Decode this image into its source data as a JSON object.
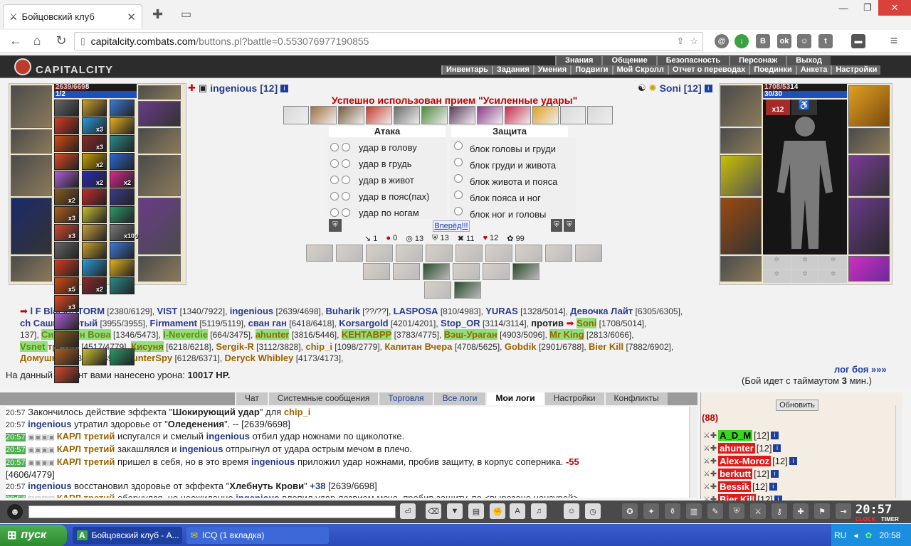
{
  "browser": {
    "tab_title": "Бойцовский клуб",
    "url_host": "capitalcity.combats.com",
    "url_path": "/buttons.pl?battle=0.553076977190855"
  },
  "site": {
    "logo": "CAPITALCITY",
    "menu_top": [
      "Знания",
      "Общение",
      "Безопасность",
      "Персонаж",
      "Выход"
    ],
    "menu_bottom": [
      "Инвентарь",
      "Задания",
      "Умения",
      "Подвиги",
      "Мой Скролл",
      "Отчет о переводах",
      "Поединки",
      "Анкета",
      "Настройки"
    ]
  },
  "battle": {
    "left_name": "ingenious [12]",
    "left_hp": "2639/6698",
    "left_mana": "1/2",
    "right_name": "Soni [12]",
    "right_hp": "1708/5314",
    "right_mana": "30/30",
    "right_buff": "x12",
    "used_msg": "Успешно использован прием \"Усиленные удары\"",
    "attack_title": "Атака",
    "defense_title": "Защита",
    "attacks": [
      "удар в голову",
      "удар в грудь",
      "удар в живот",
      "удар в пояс(пах)",
      "удар по ногам"
    ],
    "defenses": [
      "блок головы и груди",
      "блок груди и живота",
      "блок живота и пояса",
      "блок пояса и ног",
      "блок ног и головы"
    ],
    "forward": "Вперёд!!!",
    "stats": [
      "1",
      "0",
      "13",
      "13",
      "11",
      "12",
      "99"
    ],
    "spell_badges": [
      "x3",
      "x3",
      "x2",
      "x2",
      "x2",
      "x2",
      "x3",
      "x3",
      "x100",
      "x5",
      "x2",
      "x3"
    ]
  },
  "players": [
    {
      "n": "Black-STORM",
      "h": "[2380/6129]",
      "c": "pn"
    },
    {
      "n": "VIST",
      "h": "[1340/7922]",
      "c": "pn"
    },
    {
      "n": "ingenious",
      "h": "[2639/4698]",
      "c": "pn"
    },
    {
      "n": "Buharik",
      "h": "[??/??]",
      "c": "pn"
    },
    {
      "n": "LASPOSA",
      "h": "[810/4983]",
      "c": "pn"
    },
    {
      "n": "YURAS",
      "h": "[1328/5014]",
      "c": "pn"
    },
    {
      "n": "Девочка Лайт",
      "h": "[6305/6305]",
      "c": "pn"
    },
    {
      "n": "Сашка Лютый",
      "h": "[3955/3955]",
      "c": "pn"
    },
    {
      "n": "Firmament",
      "h": "[5119/5119]",
      "c": "pn"
    },
    {
      "n": "сван ган",
      "h": "[6418/6418]",
      "c": "pn"
    },
    {
      "n": "Korsargold",
      "h": "[4201/4201]",
      "c": "pn"
    },
    {
      "n": "Stop_OR",
      "h": "[3114/3114]",
      "c": "pn"
    },
    {
      "n": "Сироткин Вова",
      "h": "[1346/5473]",
      "c": "pg"
    },
    {
      "n": "I-Neverdie",
      "h": "[664/3475]",
      "c": "pg"
    },
    {
      "n": "ahunter",
      "h": "[3816/5446]",
      "c": "pb"
    },
    {
      "n": "KEHTABPP",
      "h": "[3783/4775]",
      "c": "pb"
    },
    {
      "n": "Вэш-Ураган",
      "h": "[4903/5096]",
      "c": "pb"
    },
    {
      "n": "Mr King",
      "h": "[2813/6066]",
      "c": "pb"
    },
    {
      "n": "третий",
      "h": "[4517/4779]",
      "c": "pb"
    },
    {
      "n": "Кисуня",
      "h": "[6218/6218]",
      "c": "pb"
    },
    {
      "n": "Sergik-R",
      "h": "[3112/3828]",
      "c": "pb"
    },
    {
      "n": "chip_i",
      "h": "[1098/2779]",
      "c": "pb"
    },
    {
      "n": "Капитан Вчера",
      "h": "[4708/5625]",
      "c": "pb"
    },
    {
      "n": "Gobdik",
      "h": "[2901/6788]",
      "c": "pb"
    },
    {
      "n": "Bier Kill",
      "h": "[7882/6902]",
      "c": "pb"
    },
    {
      "n": "Домушник",
      "h": "[6349/6349]",
      "c": "pb"
    },
    {
      "n": "CounterSpy",
      "h": "[6128/6371]",
      "c": "pb"
    },
    {
      "n": "Deryck Whibley",
      "h": "[4173/4173]",
      "c": "pb"
    }
  ],
  "players_extra": {
    "against": "против",
    "soni": "Soni",
    "soni_hp": "[1708/5014]",
    "vsnet": "Vsnet",
    "partial1": "l F",
    "partial2": "ch",
    "partial3": "137]"
  },
  "damage": {
    "label": "На данный момент вами нанесено урона:",
    "value": "10017 HP."
  },
  "loglink": "лог боя »»»",
  "timeout": {
    "pre": "(Бой идет с таймаутом",
    "value": "3",
    "post": "мин.)"
  },
  "chat_tabs": [
    "Чат",
    "Системные сообщения",
    "Торговля",
    "Все логи",
    "Мои логи",
    "Настройки",
    "Конфликты"
  ],
  "chat": [
    {
      "t": "20:57",
      "g": false,
      "parts": [
        [
          "",
          "Закончилось действие эффекта \""
        ],
        [
          "b",
          "Шокирующий удар"
        ],
        [
          "",
          "\" для "
        ],
        [
          "na",
          "chip_i"
        ]
      ]
    },
    {
      "t": "20:57",
      "g": false,
      "parts": [
        [
          "nb",
          "ingenious"
        ],
        [
          "",
          " утратил здоровье от \""
        ],
        [
          "b",
          "Оледенения"
        ],
        [
          "",
          "\". -- [2639/6698]"
        ]
      ]
    },
    {
      "t": "20:57",
      "g": true,
      "parts": [
        [
          "na",
          "КАРЛ третий"
        ],
        [
          "",
          " испугался и смелый "
        ],
        [
          "nb",
          "ingenious"
        ],
        [
          "",
          " отбил удар ножнами по щиколотке."
        ]
      ]
    },
    {
      "t": "20:57",
      "g": true,
      "parts": [
        [
          "na",
          "КАРЛ третий"
        ],
        [
          "",
          " закашлялся и "
        ],
        [
          "nb",
          "ingenious"
        ],
        [
          "",
          " отпрыгнул от удара острым мечом в плечо."
        ]
      ]
    },
    {
      "t": "20:57",
      "g": true,
      "parts": [
        [
          "na",
          "КАРЛ третий"
        ],
        [
          "",
          " пришел в себя, но в это время "
        ],
        [
          "nb",
          "ingenious"
        ],
        [
          "",
          " приложил удар ножнами, пробив защиту, в корпус соперника. "
        ],
        [
          "red",
          "-55"
        ]
      ]
    },
    {
      "t": "",
      "g": false,
      "parts": [
        [
          "",
          "[4606/4779]"
        ]
      ]
    },
    {
      "t": "20:57",
      "g": false,
      "parts": [
        [
          "nb",
          "ingenious"
        ],
        [
          "",
          " восстановил здоровье от эффекта \""
        ],
        [
          "b",
          "Хлебнуть Крови"
        ],
        [
          "",
          "\" "
        ],
        [
          "nb",
          "+38"
        ],
        [
          "",
          " [2639/6698]"
        ]
      ]
    },
    {
      "t": "20:57",
      "g": true,
      "parts": [
        [
          "na",
          "КАРЛ третий"
        ],
        [
          "",
          " обернулся, но неожиданно "
        ],
        [
          "nb",
          "ingenious"
        ],
        [
          "",
          " влепил удар лезвием меча, пробив защиту, по <вырезано цензурой>"
        ]
      ]
    }
  ],
  "online": {
    "refresh": "Обновить",
    "count": "(88)",
    "users": [
      {
        "n": "A_D_M",
        "lvl": "[12]",
        "bg": "#38d81c",
        "fg": "#000"
      },
      {
        "n": "ahunter",
        "lvl": "[12]",
        "bg": "#e01a1a",
        "fg": "#fff"
      },
      {
        "n": "Alex-Moroz",
        "lvl": "[12]",
        "bg": "#e01a1a",
        "fg": "#fff"
      },
      {
        "n": "berkutt",
        "lvl": "[12]",
        "bg": "#e01a1a",
        "fg": "#fff"
      },
      {
        "n": "Bessik",
        "lvl": "[12]",
        "bg": "#e01a1a",
        "fg": "#fff"
      },
      {
        "n": "Bier Kill",
        "lvl": "[12]",
        "bg": "#e01a1a",
        "fg": "#fff"
      }
    ]
  },
  "clock": "20:57",
  "taskbar": {
    "start": "пуск",
    "task1": "Бойцовский клуб - А...",
    "task2": "ICQ (1 вкладка)",
    "lang": "RU",
    "time": "20:58"
  }
}
